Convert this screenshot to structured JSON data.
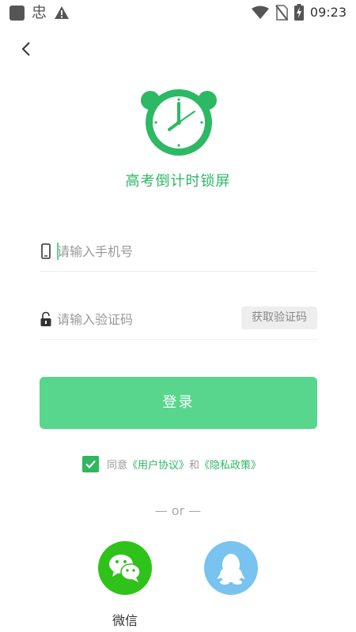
{
  "status_bar": {
    "carrier_glyph": "忠",
    "time": "09:23"
  },
  "app": {
    "title": "高考倒计时锁屏",
    "accent_color": "#2db964"
  },
  "form": {
    "phone_placeholder": "请输入手机号",
    "code_placeholder": "请输入验证码",
    "get_code_label": "获取验证码"
  },
  "login": {
    "label": "登录",
    "color": "#58d68d"
  },
  "agreement": {
    "checked": true,
    "prefix": "同意",
    "user_agreement": "《用户协议》",
    "and": "和",
    "privacy_policy": "《隐私政策》"
  },
  "divider": {
    "label": "— or —"
  },
  "social": {
    "wechat_label": "微信"
  }
}
